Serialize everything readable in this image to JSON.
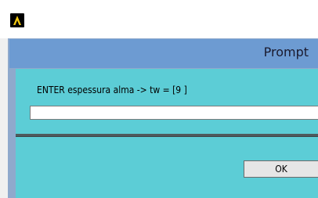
{
  "app": {
    "logo_icon": "ansys-logo-icon"
  },
  "prompt": {
    "title": "Prompt",
    "label": "ENTER espessura alma -> tw = [9 ]",
    "input_value": "",
    "ok_label": "OK"
  },
  "colors": {
    "header": "#6d9bd2",
    "body": "#5ccdd6",
    "logo_fill": "#000000",
    "logo_accent": "#f2c811"
  }
}
